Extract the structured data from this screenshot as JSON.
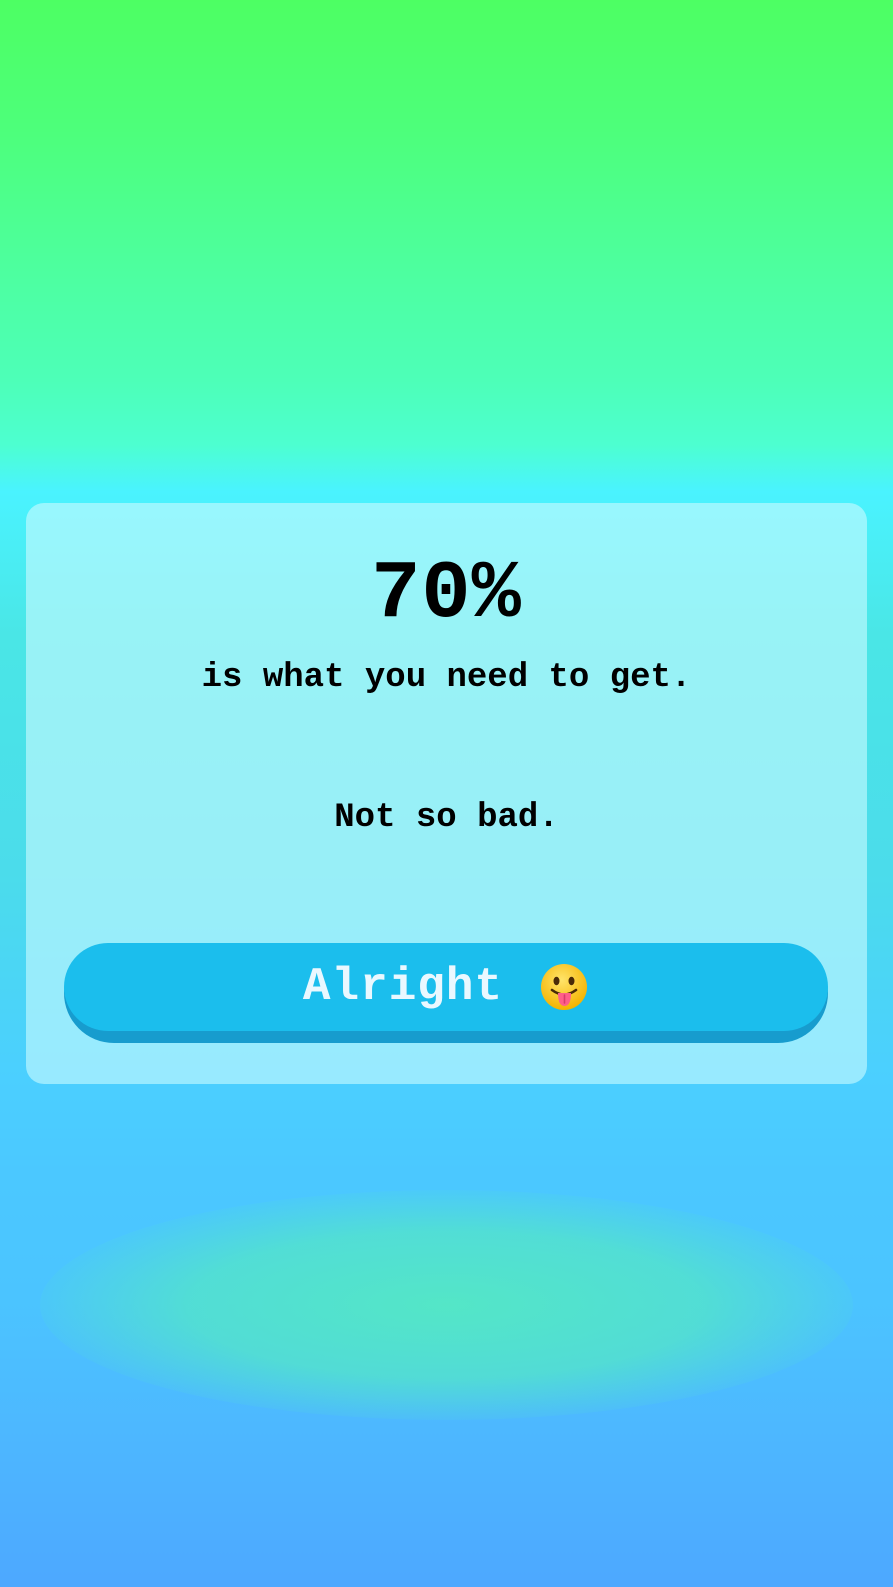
{
  "result": {
    "percent": "70%",
    "subtitle": "is what you need to get.",
    "verdict": "Not so bad."
  },
  "button": {
    "label": "Alright",
    "icon": "tongue-out-face-icon"
  },
  "colors": {
    "button": "#1bbeed",
    "button_shadow": "#179cce",
    "top_gradient": "#4dff63",
    "bottom_gradient": "#4da8ff"
  }
}
